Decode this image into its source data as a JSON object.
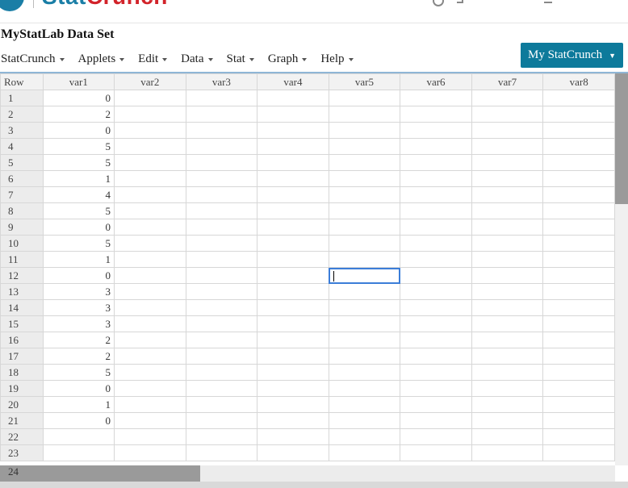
{
  "brand": {
    "stat": "Stat",
    "crunch": "Crunch"
  },
  "dataset_title": "MyStatLab Data Set",
  "menu": [
    "StatCrunch",
    "Applets",
    "Edit",
    "Data",
    "Stat",
    "Graph",
    "Help"
  ],
  "my_statcrunch_label": "My StatCrunch",
  "my_statcrunch_caret": "▼",
  "grid": {
    "row_header": "Row",
    "columns": [
      "var1",
      "var2",
      "var3",
      "var4",
      "var5",
      "var6",
      "var7",
      "var8"
    ],
    "row_numbers": [
      "1",
      "2",
      "3",
      "4",
      "5",
      "6",
      "7",
      "8",
      "9",
      "10",
      "11",
      "12",
      "13",
      "14",
      "15",
      "16",
      "17",
      "18",
      "19",
      "20",
      "21",
      "22",
      "23"
    ],
    "var1": [
      "0",
      "2",
      "0",
      "5",
      "5",
      "1",
      "4",
      "5",
      "0",
      "5",
      "1",
      "0",
      "3",
      "3",
      "3",
      "2",
      "2",
      "5",
      "0",
      "1",
      "0",
      "",
      ""
    ],
    "active_cell": {
      "row": 12,
      "column": "var5"
    }
  },
  "partial_row_label": "24",
  "colors": {
    "accent": "#0d7a9b",
    "brand_blue": "#1a7ea6",
    "brand_red": "#d2232a",
    "active_border": "#3b7dd8"
  }
}
